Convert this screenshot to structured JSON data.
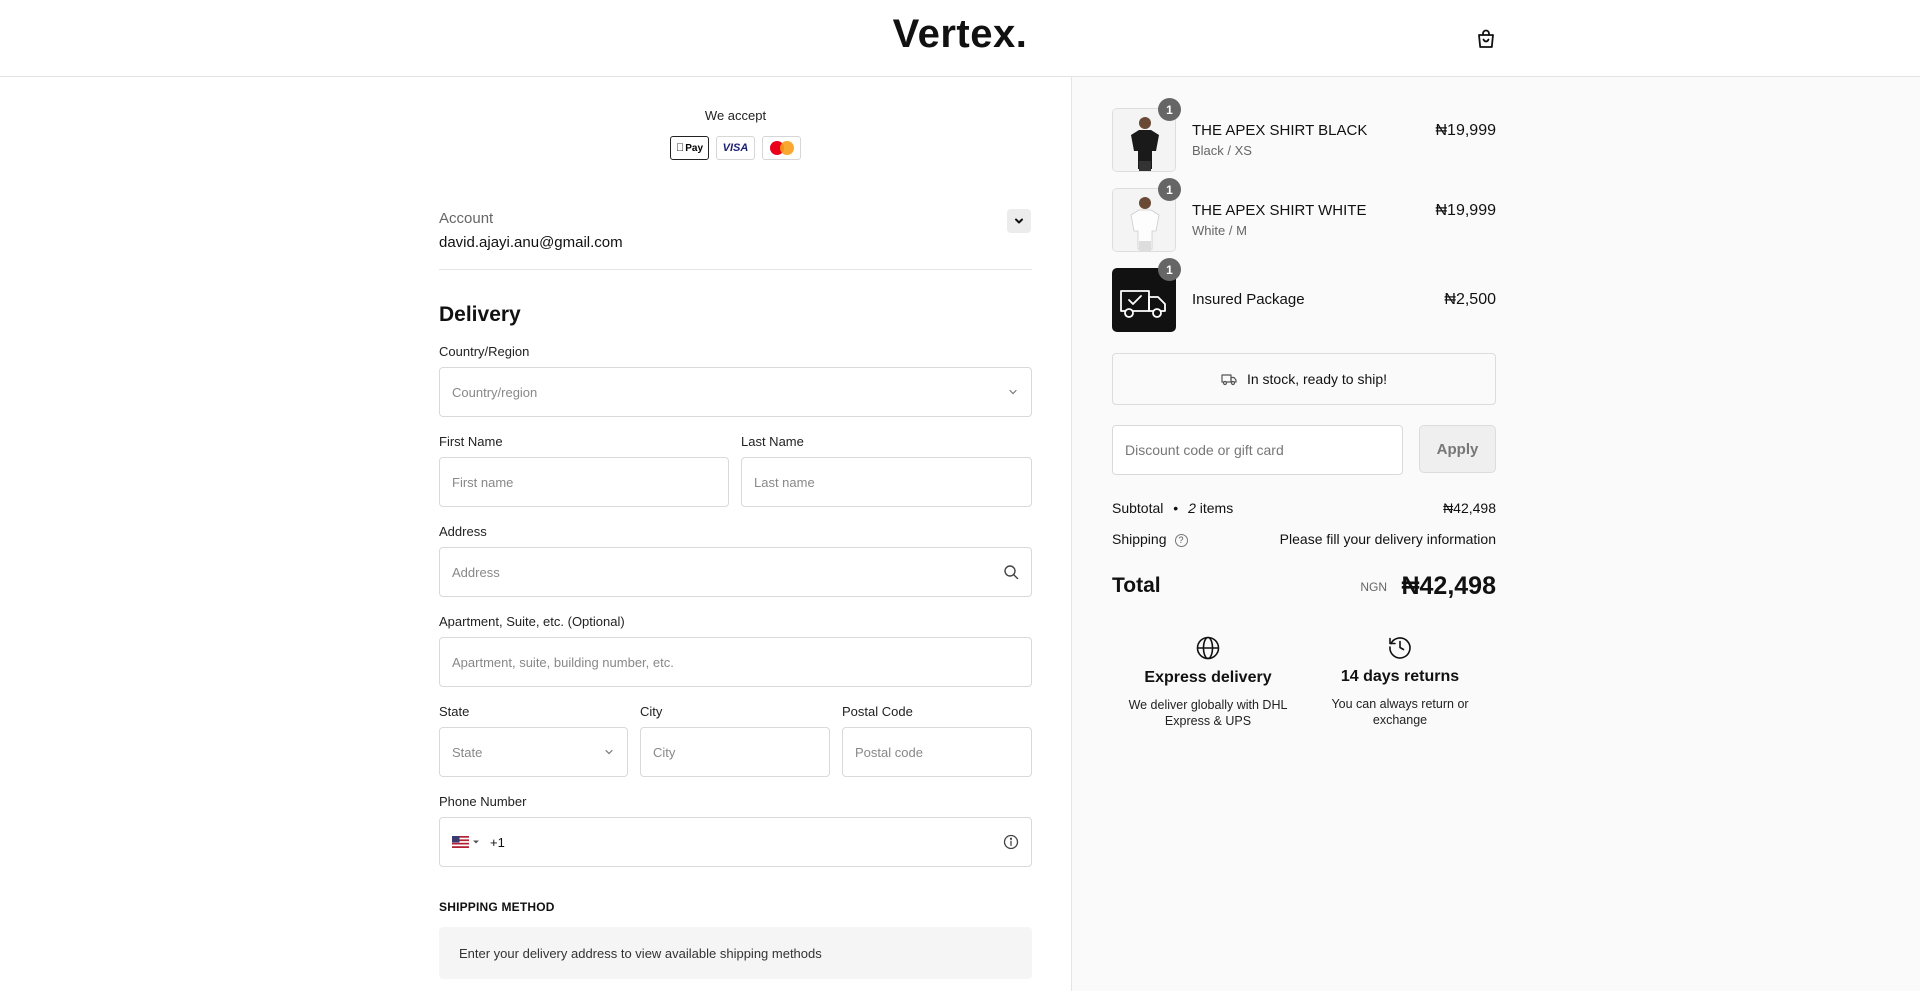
{
  "header": {
    "logo": "Vertex.",
    "cart_icon": "shopping-bag-icon"
  },
  "payment": {
    "accept_label": "We accept",
    "methods": [
      "Pay",
      "VISA",
      "mastercard"
    ]
  },
  "account": {
    "label": "Account",
    "email": "david.ajayi.anu@gmail.com"
  },
  "delivery": {
    "title": "Delivery",
    "country": {
      "label": "Country/Region",
      "placeholder": "Country/region"
    },
    "first_name": {
      "label": "First Name",
      "placeholder": "First name"
    },
    "last_name": {
      "label": "Last Name",
      "placeholder": "Last name"
    },
    "address": {
      "label": "Address",
      "placeholder": "Address"
    },
    "apartment": {
      "label": "Apartment, Suite, etc. (Optional)",
      "placeholder": "Apartment, suite, building number, etc."
    },
    "state": {
      "label": "State",
      "placeholder": "State"
    },
    "city": {
      "label": "City",
      "placeholder": "City"
    },
    "postal": {
      "label": "Postal Code",
      "placeholder": "Postal code"
    },
    "phone": {
      "label": "Phone Number",
      "dial_code": "+1",
      "flag": "us-flag-icon"
    }
  },
  "shipping_method": {
    "title": "SHIPPING METHOD",
    "message": "Enter your delivery address to view available shipping methods"
  },
  "cart": {
    "items": [
      {
        "qty": "1",
        "name": "THE APEX SHIRT BLACK",
        "variant": "Black / XS",
        "price": "₦19,999"
      },
      {
        "qty": "1",
        "name": "THE APEX SHIRT WHITE",
        "variant": "White / M",
        "price": "₦19,999"
      },
      {
        "qty": "1",
        "name": "Insured Package",
        "price": "₦2,500"
      }
    ],
    "stock_message": "In stock, ready to ship!",
    "discount_placeholder": "Discount code or gift card",
    "apply_label": "Apply",
    "subtotal_label": "Subtotal",
    "subtotal_sep": "•",
    "item_count": "2",
    "items_word": "items",
    "subtotal_value": "₦42,498",
    "shipping_label": "Shipping",
    "shipping_value": "Please fill your delivery information",
    "total_label": "Total",
    "total_currency": "NGN",
    "total_value": "₦42,498"
  },
  "features": [
    {
      "icon": "globe-icon",
      "title": "Express delivery",
      "desc": "We deliver globally with DHL Express & UPS"
    },
    {
      "icon": "history-icon",
      "title": "14 days returns",
      "desc": "You can always return or exchange"
    }
  ]
}
